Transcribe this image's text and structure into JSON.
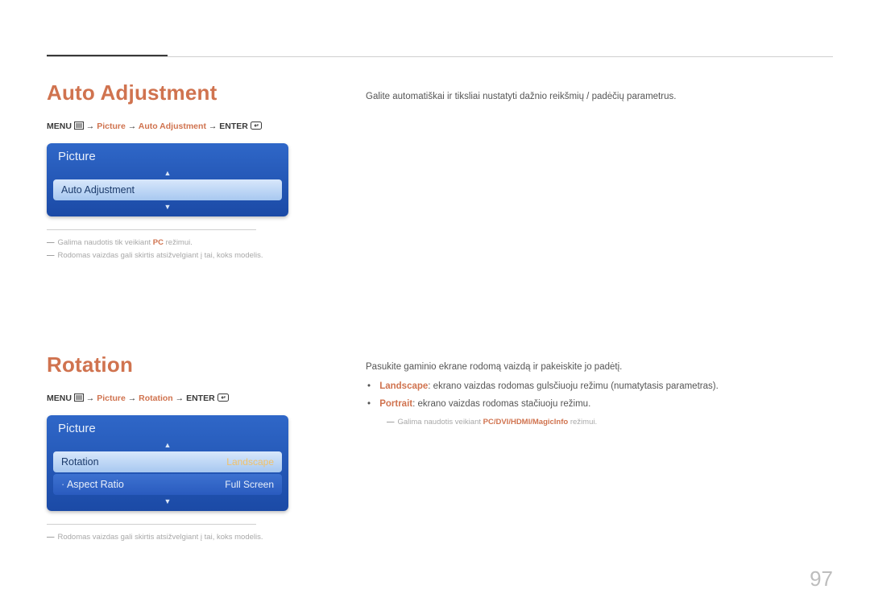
{
  "page_number": "97",
  "section1": {
    "heading": "Auto Adjustment",
    "path": {
      "menu": "MENU",
      "seg1": "Picture",
      "seg2": "Auto Adjustment",
      "enter": "ENTER"
    },
    "osd": {
      "title": "Picture",
      "item": "Auto Adjustment"
    },
    "footnotes": {
      "f1_pre": "Galima naudotis tik veikiant ",
      "f1_hl": "PC",
      "f1_post": " režimui.",
      "f2": "Rodomas vaizdas gali skirtis atsižvelgiant į tai, koks modelis."
    },
    "body": "Galite automatiškai ir tiksliai nustatyti dažnio reikšmių / padėčių parametrus."
  },
  "section2": {
    "heading": "Rotation",
    "path": {
      "menu": "MENU",
      "seg1": "Picture",
      "seg2": "Rotation",
      "enter": "ENTER"
    },
    "osd": {
      "title": "Picture",
      "row1_label": "Rotation",
      "row1_value": "Landscape",
      "row2_label": "Aspect Ratio",
      "row2_value": "Full Screen"
    },
    "footnotes": {
      "f1": "Rodomas vaizdas gali skirtis atsižvelgiant į tai, koks modelis."
    },
    "body": {
      "intro": "Pasukite gaminio ekrane rodomą vaizdą ir pakeiskite jo padėtį.",
      "li1_term": "Landscape",
      "li1_text": ": ekrano vaizdas rodomas gulsčiuoju režimu (numatytasis parametras).",
      "li2_term": "Portrait",
      "li2_text": ": ekrano vaizdas rodomas stačiuoju režimu.",
      "subnote_pre": "Galima naudotis veikiant ",
      "subnote_hl": "PC/DVI/HDMI/MagicInfo",
      "subnote_post": " režimui."
    }
  }
}
